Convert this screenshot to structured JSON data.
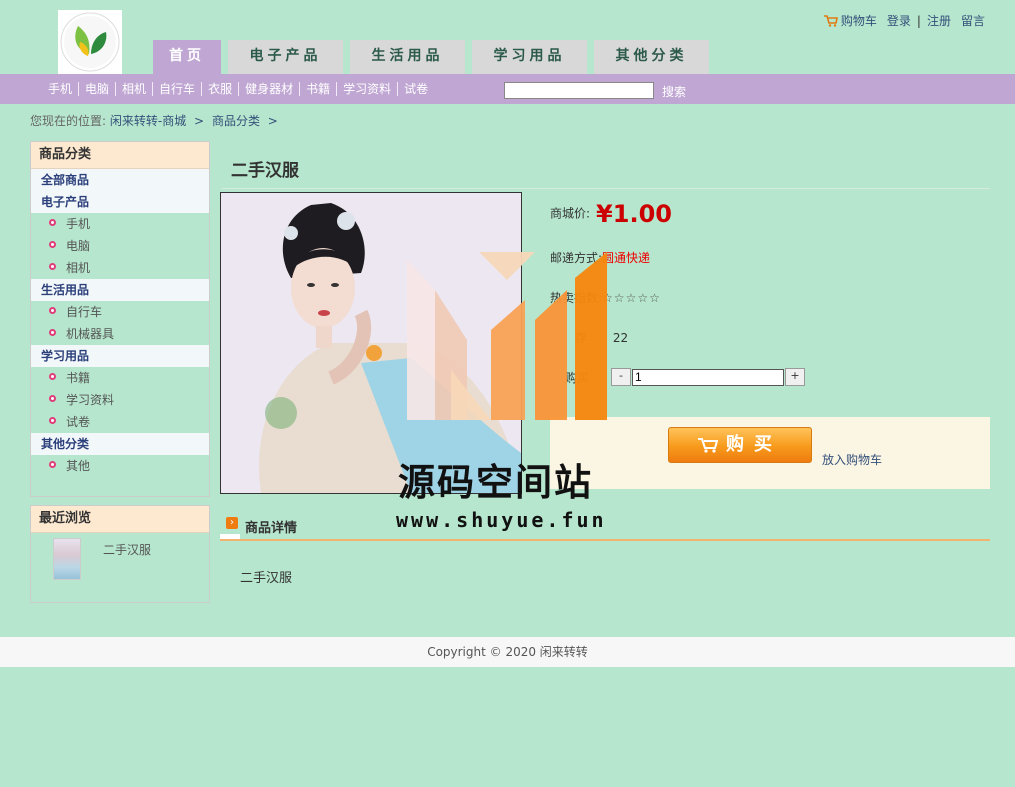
{
  "header": {
    "links": {
      "cart": "购物车",
      "login": "登录",
      "sep": "|",
      "register": "注册",
      "message": "留言"
    },
    "nav_tabs": [
      "首页",
      "电子产品",
      "生活用品",
      "学习用品",
      "其他分类"
    ]
  },
  "category_bar": {
    "items": [
      "手机",
      "电脑",
      "相机",
      "自行车",
      "衣服",
      "健身器材",
      "书籍",
      "学习资料",
      "试卷"
    ],
    "search_value": "",
    "search_label": "搜索"
  },
  "breadcrumb": {
    "prefix": "您现在的位置:",
    "items": [
      "闲来转转-商城",
      "商品分类"
    ],
    "arrow": ">"
  },
  "sidebar": {
    "category_title": "商品分类",
    "all_label": "全部商品",
    "groups": [
      {
        "label": "电子产品",
        "items": [
          "手机",
          "电脑",
          "相机"
        ]
      },
      {
        "label": "生活用品",
        "items": [
          "自行车",
          "机械器具"
        ]
      },
      {
        "label": "学习用品",
        "items": [
          "书籍",
          "学习资料",
          "试卷"
        ]
      },
      {
        "label": "其他分类",
        "items": [
          "其他"
        ]
      }
    ],
    "recent_title": "最近浏览",
    "recent_item": "二手汉服"
  },
  "product": {
    "title": "二手汉服",
    "price_label": "商城价:",
    "price": "¥1.00",
    "shipping_label": "邮递方式:",
    "shipping_value": "圆通快递",
    "hot_label": "热卖指数:",
    "hot_stars": "☆☆☆☆☆",
    "stock_label": "存",
    "stock_value": "22",
    "qty_label": "购买",
    "qty_value": "1",
    "minus": "-",
    "plus": "+",
    "buy_label": "购买",
    "add_cart_label": "放入购物车",
    "detail_title": "商品详情",
    "detail_text": "二手汉服"
  },
  "footer": {
    "text": "Copyright © 2020 闲来转转"
  },
  "watermark": {
    "title": "源码空间站",
    "url": "www.shuyue.fun"
  },
  "colors": {
    "background": "#b6e6cd",
    "nav_active": "#c0a7d3",
    "price": "#cc0000",
    "buy_button": "#f79a1b"
  }
}
